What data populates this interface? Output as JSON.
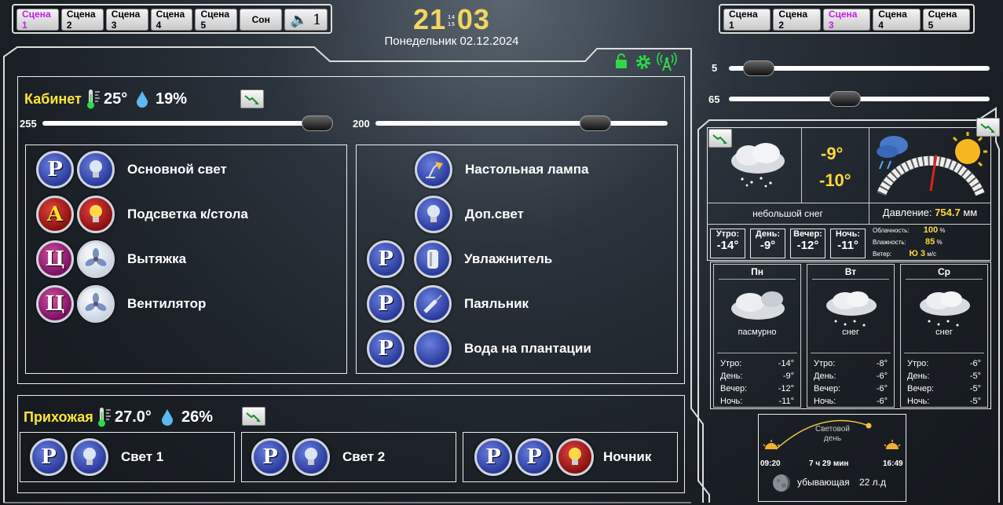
{
  "top_left_scenes": {
    "buttons": [
      "Сцена 1",
      "Сцена 2",
      "Сцена 3",
      "Сцена 4",
      "Сцена 5",
      "Сон"
    ],
    "speaker_value": "1"
  },
  "top_right_scenes": {
    "buttons": [
      "Сцена 1",
      "Сцена 2",
      "Сцена 3",
      "Сцена 4",
      "Сцена 5"
    ]
  },
  "clock": {
    "hours": "21",
    "minutes": "03",
    "sec_top": "14",
    "sec_bottom": "15",
    "date": "Понедельник 02.12.2024"
  },
  "right_sliders": [
    {
      "value": "5",
      "level": 0.03
    },
    {
      "value": "65",
      "level": 0.45
    }
  ],
  "cabinet": {
    "title": "Кабинет",
    "temp": "25°",
    "humidity": "19%",
    "slider_left": {
      "value": "255",
      "level": 1.0
    },
    "slider_right": {
      "value": "200",
      "level": 0.78
    },
    "left_devices": [
      {
        "label": "Основной свет",
        "mode": "P"
      },
      {
        "label": "Подсветка к/стола",
        "mode": "A"
      },
      {
        "label": "Вытяжка",
        "mode": "Ц"
      },
      {
        "label": "Вентилятор",
        "mode": "Ц"
      }
    ],
    "right_devices": [
      {
        "label": "Настольная лампа"
      },
      {
        "label": "Доп.свет"
      },
      {
        "label": "Увлажнитель",
        "mode": "P"
      },
      {
        "label": "Паяльник",
        "mode": "P"
      },
      {
        "label": "Вода на плантации",
        "mode": "P"
      }
    ]
  },
  "hallway": {
    "title": "Прихожая",
    "temp": "27.0°",
    "humidity": "26%",
    "devices": [
      {
        "label": "Свет 1"
      },
      {
        "label": "Свет 2"
      },
      {
        "label": "Ночник"
      }
    ]
  },
  "weather": {
    "temp_now": "-9°",
    "temp_feels": "-10°",
    "condition": "небольшой снег",
    "pressure_label": "Давление:",
    "pressure_value": "754.7",
    "pressure_unit": "мм",
    "parts": [
      {
        "label": "Утро:",
        "value": "-14°"
      },
      {
        "label": "День:",
        "value": "-9°"
      },
      {
        "label": "Вечер:",
        "value": "-12°"
      },
      {
        "label": "Ночь:",
        "value": "-11°"
      }
    ],
    "cloud_label": "Облачность:",
    "cloud_value": "100",
    "cloud_unit": "%",
    "hum_label": "Влажность:",
    "hum_value": "85",
    "hum_unit": "%",
    "wind_label": "Ветер:",
    "wind_value": "Ю 3",
    "wind_unit": "м/с",
    "forecast": [
      {
        "day": "Пн",
        "cond": "пасмурно",
        "rows": [
          [
            "Утро:",
            "-14°"
          ],
          [
            "День:",
            "-9°"
          ],
          [
            "Вечер:",
            "-12°"
          ],
          [
            "Ночь:",
            "-11°"
          ]
        ]
      },
      {
        "day": "Вт",
        "cond": "снег",
        "rows": [
          [
            "Утро:",
            "-8°"
          ],
          [
            "День:",
            "-6°"
          ],
          [
            "Вечер:",
            "-6°"
          ],
          [
            "Ночь:",
            "-6°"
          ]
        ]
      },
      {
        "day": "Ср",
        "cond": "снег",
        "rows": [
          [
            "Утро:",
            "-6°"
          ],
          [
            "День:",
            "-5°"
          ],
          [
            "Вечер:",
            "-5°"
          ],
          [
            "Ночь:",
            "-5°"
          ]
        ]
      }
    ],
    "sun": {
      "label_line1": "Световой",
      "label_line2": "день",
      "sunrise": "09:20",
      "duration": "7 ч 29 мин",
      "sunset": "16:49"
    },
    "moon": {
      "phase": "убывающая",
      "age": "22 л.д"
    }
  },
  "colors": {
    "accent": "#f2d75e",
    "active_scene": "#c020e0",
    "status_green": "#2fd84a"
  }
}
